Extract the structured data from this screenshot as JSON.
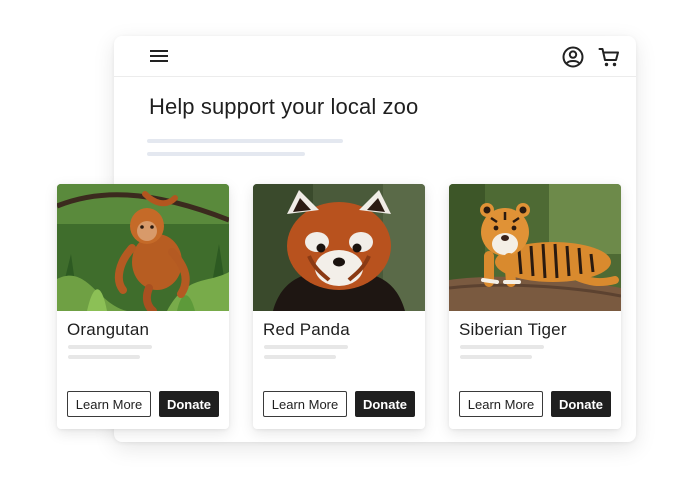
{
  "header": {
    "menu_icon": "hamburger-menu-icon",
    "account_icon": "user-circle-icon",
    "cart_icon": "shopping-cart-icon"
  },
  "main": {
    "title": "Help support your local zoo"
  },
  "cards": [
    {
      "title": "Orangutan",
      "learn_label": "Learn More",
      "donate_label": "Donate",
      "image": "orangutan-photo"
    },
    {
      "title": "Red Panda",
      "learn_label": "Learn More",
      "donate_label": "Donate",
      "image": "red-panda-photo"
    },
    {
      "title": "Siberian Tiger",
      "learn_label": "Learn More",
      "donate_label": "Donate",
      "image": "siberian-tiger-photo"
    }
  ],
  "colors": {
    "text": "#1f1f1f",
    "button_dark": "#1f1f1f",
    "skeleton_line": "#e4e8f0"
  }
}
